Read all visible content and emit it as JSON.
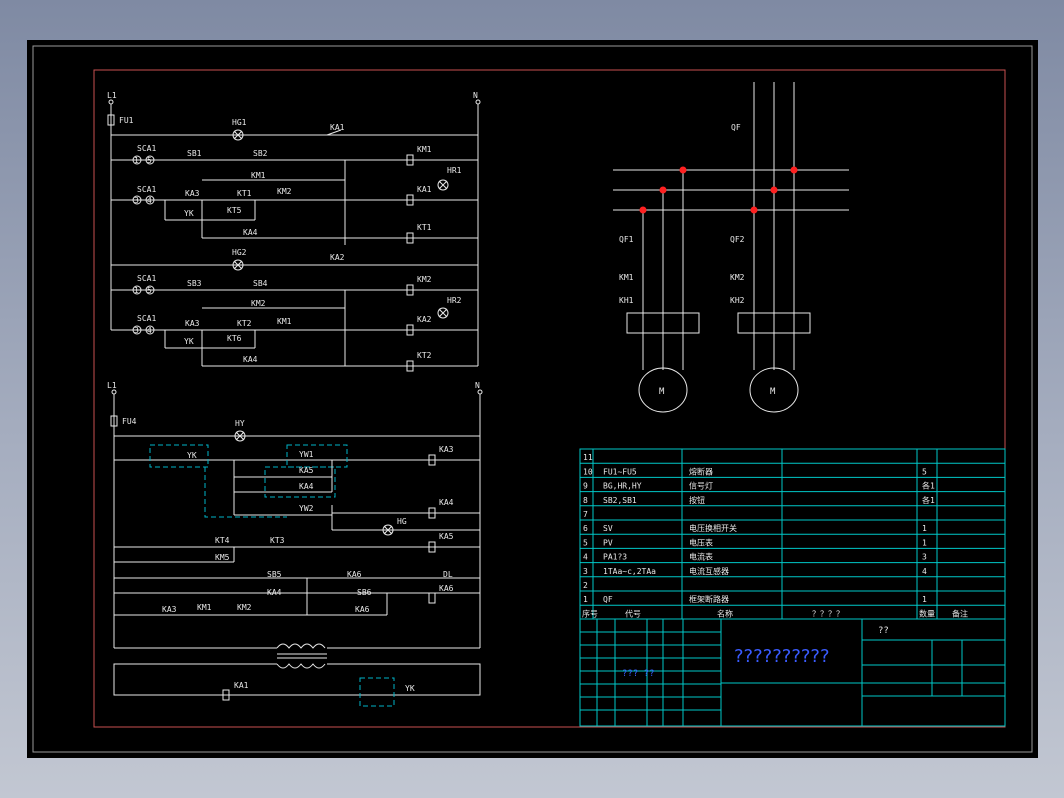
{
  "circuit_top": {
    "rail_left": "L1",
    "rail_right": "N",
    "fuse": "FU1",
    "lamp_row1": "HG1",
    "ka_row1": "KA1",
    "row_sb1": {
      "switch": "SCA1",
      "pos1": "1",
      "pos2": "5",
      "sb": "SB1",
      "sb2": "SB2",
      "coil": "KM1",
      "lamp": "HR1"
    },
    "row_km1": {
      "label": "KM1"
    },
    "row_auto": {
      "switch": "SCA1",
      "pos1": "3",
      "pos2": "4",
      "ka": "KA3",
      "kt": "KT1",
      "km2": "KM2",
      "coil": "KA1",
      "lamp": "HR1"
    },
    "row_yk": {
      "label": "YK",
      "kt5": "KT5"
    },
    "row_kt1": {
      "ka4": "KA4",
      "coil": "KT1"
    },
    "lamp_row2": "HG2",
    "ka_row2": "KA2",
    "row_sb3": {
      "switch": "SCA1",
      "pos1": "1",
      "pos2": "5",
      "sb": "SB3",
      "sb4": "SB4",
      "coil": "KM2",
      "lamp": "HR2"
    },
    "row_km2": {
      "label": "KM2"
    },
    "row_auto2": {
      "switch": "SCA1",
      "pos1": "3",
      "pos2": "4",
      "ka": "KA3",
      "kt": "KT2",
      "km1": "KM1",
      "coil": "KA2",
      "lamp": "HR2"
    },
    "row_yk2": {
      "label": "YK",
      "kt6": "KT6"
    },
    "row_kt2": {
      "ka4": "KA4",
      "coil": "KT2"
    }
  },
  "circuit_bottom": {
    "rail_left": "L1",
    "rail_right": "N",
    "fuse": "FU4",
    "lamp": "HY",
    "yk": "YK",
    "yw1": "YW1",
    "ka3_coil": "KA3",
    "ka5": "KA5",
    "ka4": "KA4",
    "yw2": "YW2",
    "ka4_coil": "KA4",
    "hg": "HG",
    "kt4": "KT4",
    "kt3": "KT3",
    "ka5_coil": "KA5",
    "km5": "KM5",
    "sb5": "SB5",
    "ka6": "KA6",
    "dl": "DL",
    "ka4b": "KA4",
    "sb6": "SB6",
    "ka6_coil": "KA6",
    "ka3": "KA3",
    "km1": "KM1",
    "km2": "KM2",
    "ka6b": "KA6",
    "ka1_coil": "KA1",
    "yk_box": "YK"
  },
  "power": {
    "main_breaker": "QF",
    "branch1": {
      "breaker": "QF1",
      "contactor": "KM1",
      "relay": "KH1",
      "motor": "M"
    },
    "branch2": {
      "breaker": "QF2",
      "contactor": "KM2",
      "relay": "KH2",
      "motor": "M"
    }
  },
  "bom": {
    "rows": [
      {
        "no": "11",
        "code": "",
        "name": "",
        "qty": ""
      },
      {
        "no": "10",
        "code": "FU1~FU5",
        "name": "熔断器",
        "qty": "5"
      },
      {
        "no": "9",
        "code": "BG,HR,HY",
        "name": "信号灯",
        "qty": "各1"
      },
      {
        "no": "8",
        "code": "SB2,SB1",
        "name": "按钮",
        "qty": "各1"
      },
      {
        "no": "7",
        "code": "",
        "name": "",
        "qty": ""
      },
      {
        "no": "6",
        "code": "SV",
        "name": "电压换相开关",
        "qty": "1"
      },
      {
        "no": "5",
        "code": "PV",
        "name": "电压表",
        "qty": "1"
      },
      {
        "no": "4",
        "code": "PA1?3",
        "name": "电流表",
        "qty": "3"
      },
      {
        "no": "3",
        "code": "1TAa~c,2TAa",
        "name": "电流互感器",
        "qty": "4"
      },
      {
        "no": "2",
        "code": "",
        "name": "",
        "qty": ""
      },
      {
        "no": "1",
        "code": "QF",
        "name": "框架断路器",
        "qty": "1"
      }
    ],
    "header": {
      "no": "序号",
      "code": "代号",
      "name": "名称",
      "spec": "？？？？",
      "qty": "数量",
      "remark": "备注"
    }
  },
  "title_block": {
    "title": "??????????",
    "corner": "??",
    "small_text": "??? ??"
  },
  "colors": {
    "background": "#000000",
    "wire": "#e8e8e8",
    "table": "#00c8c8",
    "border": "#c85050",
    "node": "#ff2020",
    "question": "#3a5cff"
  }
}
